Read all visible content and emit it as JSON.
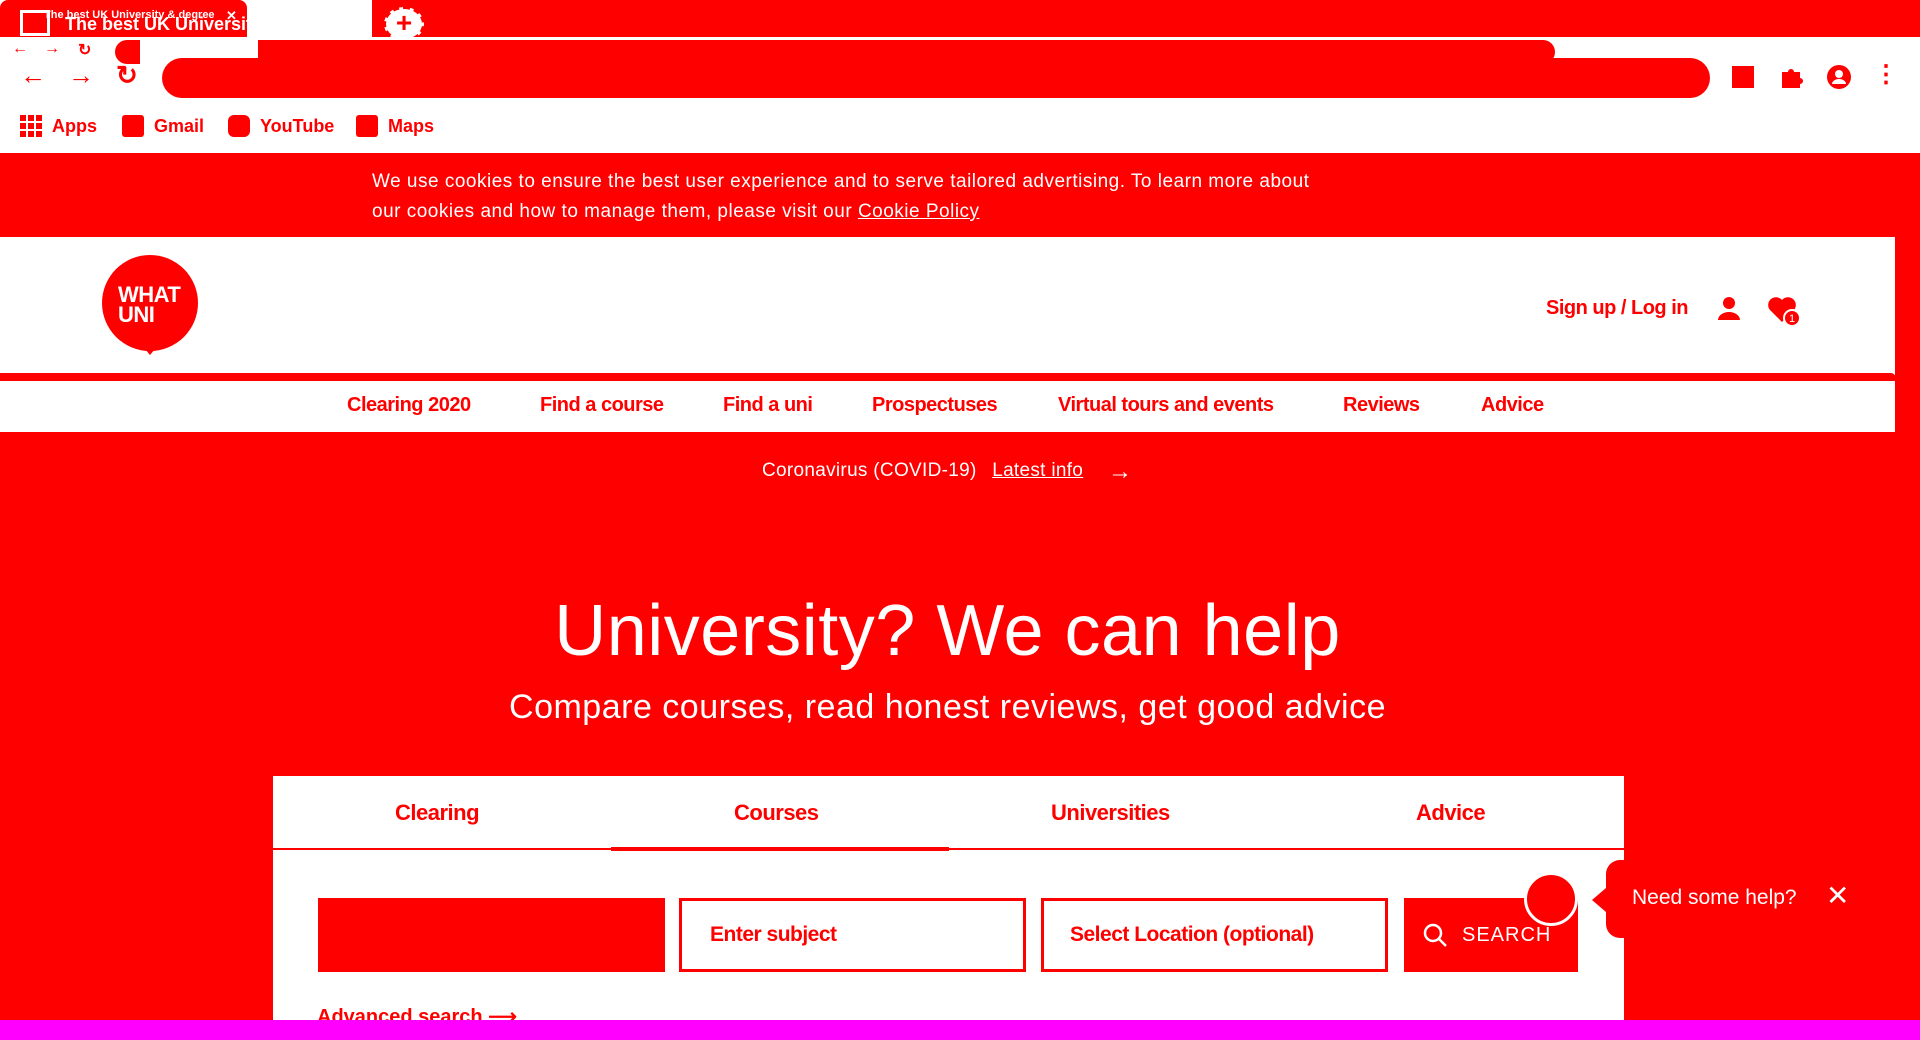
{
  "browser": {
    "tab_title": "The best UK University",
    "tab_title_small": "The best UK University & degree",
    "tab_close": "✕",
    "new_tab_symbol": "+",
    "window_controls": {
      "minimize": "—",
      "restore": "❐",
      "maximize": "⧉",
      "close": "✕"
    },
    "bookmarks": [
      {
        "label": "Apps",
        "icon": "apps-grid-icon"
      },
      {
        "label": "Gmail",
        "icon": "gmail-icon"
      },
      {
        "label": "YouTube",
        "icon": "youtube-icon"
      },
      {
        "label": "Maps",
        "icon": "maps-icon"
      }
    ]
  },
  "cookie_banner": {
    "line1": "We use cookies to ensure the best user experience and to serve tailored advertising. To learn more about",
    "line2": "our cookies and how to manage them, please visit our",
    "link": "Cookie Policy"
  },
  "header": {
    "logo_line1": "WHAT",
    "logo_line2": "UNI",
    "signin": "Sign up / Log in",
    "wishlist_count": "1"
  },
  "nav": {
    "items": [
      "Clearing 2020",
      "Find a course",
      "Find a uni",
      "Prospectuses",
      "Virtual tours and events",
      "Reviews",
      "Advice"
    ]
  },
  "corona": {
    "text": "Coronavirus (COVID-19)",
    "link": "Latest info"
  },
  "hero": {
    "title": "University? We can help",
    "subtitle": "Compare courses, read honest reviews, get good advice"
  },
  "search_panel": {
    "tabs": [
      "Clearing",
      "Courses",
      "Universities",
      "Advice"
    ],
    "active_tab": "Courses",
    "subject_placeholder": "Enter subject",
    "location_placeholder": "Select Location (optional)",
    "search_label": "SEARCH",
    "advanced_label": "Advanced search"
  },
  "chat": {
    "text": "Need some help?",
    "close": "✕"
  },
  "colors": {
    "primary": "#ff0000",
    "white": "#ffffff",
    "bottom_strip": "#ff00ff"
  }
}
